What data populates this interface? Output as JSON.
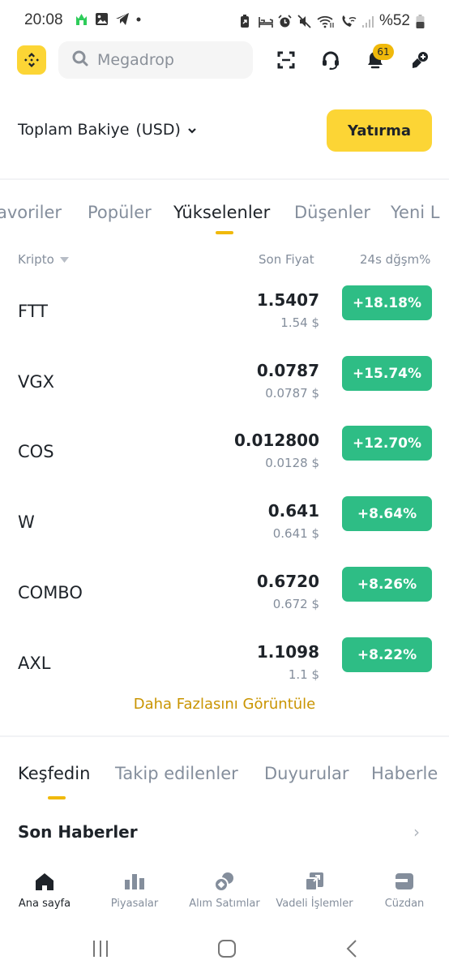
{
  "status_bar": {
    "time": "20:08",
    "battery": "%52",
    "left_icons": [
      "app-notification-icon",
      "image-icon",
      "telegram-icon",
      "dot-icon"
    ],
    "right_icons": [
      "battery-saver-icon",
      "sleep-mode-icon",
      "alarm-icon",
      "mute-icon",
      "wifi-icon",
      "wifi-call-icon",
      "signal-icon",
      "battery-icon"
    ]
  },
  "header": {
    "search_placeholder": "Megadrop",
    "notification_count": "61",
    "icons": [
      "scan-icon",
      "headset-icon",
      "bell-icon",
      "profile-add-icon"
    ]
  },
  "balance": {
    "label": "Toplam Bakiye",
    "currency": "(USD)",
    "deposit_button": "Yatırma"
  },
  "market_tabs": {
    "items": [
      "avoriler",
      "Popüler",
      "Yükselenler",
      "Düşenler",
      "Yeni L"
    ],
    "active": "Yükselenler"
  },
  "columns": {
    "crypto": "Kripto",
    "last_price": "Son Fiyat",
    "change_24h": "24s dğşm%"
  },
  "rows": [
    {
      "symbol": "FTT",
      "price": "1.5407",
      "price_usd": "1.54 $",
      "change": "+18.18%"
    },
    {
      "symbol": "VGX",
      "price": "0.0787",
      "price_usd": "0.0787 $",
      "change": "+15.74%"
    },
    {
      "symbol": "COS",
      "price": "0.012800",
      "price_usd": "0.0128 $",
      "change": "+12.70%"
    },
    {
      "symbol": "W",
      "price": "0.641",
      "price_usd": "0.641 $",
      "change": "+8.64%"
    },
    {
      "symbol": "COMBO",
      "price": "0.6720",
      "price_usd": "0.672 $",
      "change": "+8.26%"
    },
    {
      "symbol": "AXL",
      "price": "1.1098",
      "price_usd": "1.1 $",
      "change": "+8.22%"
    }
  ],
  "view_more": "Daha Fazlasını Görüntüle",
  "discover_tabs": {
    "items": [
      "Keşfedin",
      "Takip edilenler",
      "Duyurular",
      "Haberle"
    ],
    "active": "Keşfedin"
  },
  "news": {
    "title": "Son Haberler",
    "chevron": "›"
  },
  "bottom_nav": [
    {
      "label": "Ana sayfa",
      "icon": "home-icon",
      "active": true
    },
    {
      "label": "Piyasalar",
      "icon": "markets-icon",
      "active": false
    },
    {
      "label": "Alım Satımlar",
      "icon": "trade-icon",
      "active": false
    },
    {
      "label": "Vadeli İşlemler",
      "icon": "futures-icon",
      "active": false
    },
    {
      "label": "Cüzdan",
      "icon": "wallet-icon",
      "active": false
    }
  ],
  "colors": {
    "brand_yellow": "#fcd535",
    "accent_yellow": "#f0b90b",
    "link_gold": "#c99400",
    "positive_green": "#2ebd85",
    "text_primary": "#1e2329",
    "text_secondary": "#848e9c"
  }
}
